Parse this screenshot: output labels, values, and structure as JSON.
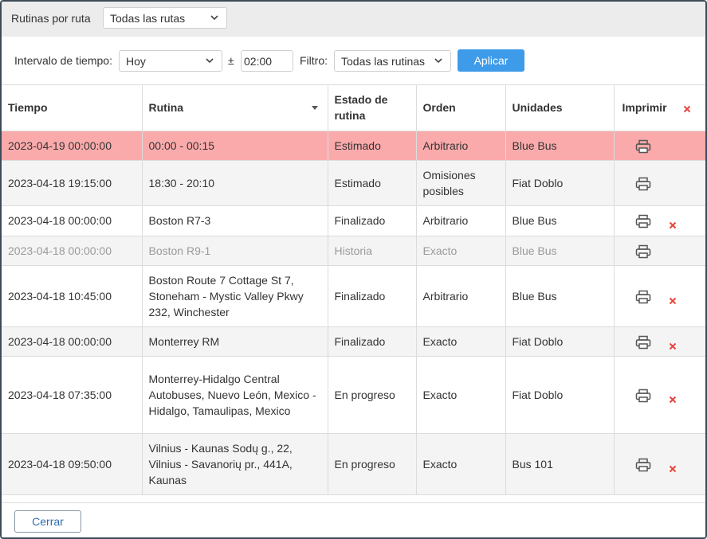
{
  "topbar": {
    "routes_label": "Rutinas por ruta",
    "routes_select": "Todas las rutas"
  },
  "filters": {
    "interval_label": "Intervalo de tiempo:",
    "interval_select": "Hoy",
    "plusminus": "±",
    "time_value": "02:00",
    "filter_label": "Filtro:",
    "filter_select": "Todas las rutinas",
    "apply_label": "Aplicar"
  },
  "table": {
    "headers": {
      "time": "Tiempo",
      "route": "Rutina",
      "state": "Estado de rutina",
      "order": "Orden",
      "units": "Unidades",
      "print": "Imprimir"
    },
    "rows": [
      {
        "time": "2023-04-19 00:00:00",
        "route": "00:00 - 00:15",
        "state": "Estimado",
        "order": "Arbitrario",
        "units": "Blue Bus",
        "deletable": false,
        "status": "active"
      },
      {
        "time": "2023-04-18 19:15:00",
        "route": "18:30 - 20:10",
        "state": "Estimado",
        "order": "Omisiones posibles",
        "units": "Fiat Doblo",
        "deletable": false,
        "status": "normal"
      },
      {
        "time": "2023-04-18 00:00:00",
        "route": "Boston R7-3",
        "state": "Finalizado",
        "order": "Arbitrario",
        "units": "Blue Bus",
        "deletable": true,
        "status": "normal"
      },
      {
        "time": "2023-04-18 00:00:00",
        "route": "Boston R9-1",
        "state": "Historia",
        "order": "Exacto",
        "units": "Blue Bus",
        "deletable": false,
        "status": "muted"
      },
      {
        "time": "2023-04-18 10:45:00",
        "route": "Boston Route 7 Cottage St 7, Stoneham - Mystic Valley Pkwy 232, Winchester",
        "state": "Finalizado",
        "order": "Arbitrario",
        "units": "Blue Bus",
        "deletable": true,
        "status": "normal"
      },
      {
        "time": "2023-04-18 00:00:00",
        "route": "Monterrey RM",
        "state": "Finalizado",
        "order": "Exacto",
        "units": "Fiat Doblo",
        "deletable": true,
        "status": "normal"
      },
      {
        "time": "2023-04-18 07:35:00",
        "route": "Monterrey-Hidalgo Central Autobuses, Nuevo León, Mexico - Hidalgo, Tamaulipas, Mexico",
        "state": "En progreso",
        "order": "Exacto",
        "units": "Fiat Doblo",
        "deletable": true,
        "status": "normal"
      },
      {
        "time": "2023-04-18 09:50:00",
        "route": "Vilnius - Kaunas Sodų g., 22, Vilnius - Savanorių pr., 441A, Kaunas",
        "state": "En progreso",
        "order": "Exacto",
        "units": "Bus 101",
        "deletable": true,
        "status": "normal"
      }
    ]
  },
  "footer": {
    "close_label": "Cerrar"
  },
  "colors": {
    "active_row": "#fbaaab",
    "apply_button": "#3d9be9",
    "delete_icon": "#e8453c",
    "frame_border": "#3d4a58"
  }
}
